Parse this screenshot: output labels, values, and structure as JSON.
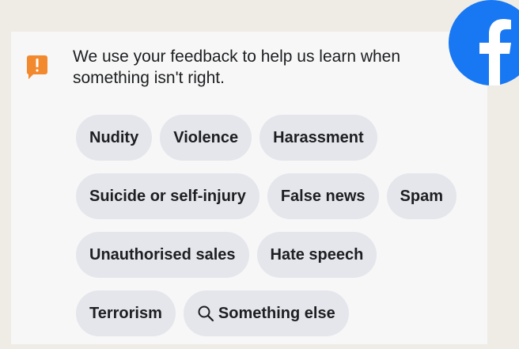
{
  "notice": {
    "icon": "warning-exclamation-icon",
    "icon_color": "#f2892e",
    "text": "We use your feedback to help us learn when something isn't right."
  },
  "brand": {
    "logo": "facebook-logo-icon",
    "color": "#1877f2"
  },
  "chips": {
    "rows": [
      [
        {
          "label": "Nudity"
        },
        {
          "label": "Violence"
        },
        {
          "label": "Harassment"
        }
      ],
      [
        {
          "label": "Suicide or self-injury"
        },
        {
          "label": "False news"
        },
        {
          "label": "Spam"
        }
      ],
      [
        {
          "label": "Unauthorised sales"
        },
        {
          "label": "Hate speech"
        }
      ],
      [
        {
          "label": "Terrorism"
        },
        {
          "label": "Something else",
          "icon": "search-icon"
        }
      ]
    ]
  },
  "colors": {
    "chip_background": "#e4e6eb",
    "page_background": "#efece6",
    "card_background": "#f7f7f7",
    "text": "#1c1e21"
  }
}
